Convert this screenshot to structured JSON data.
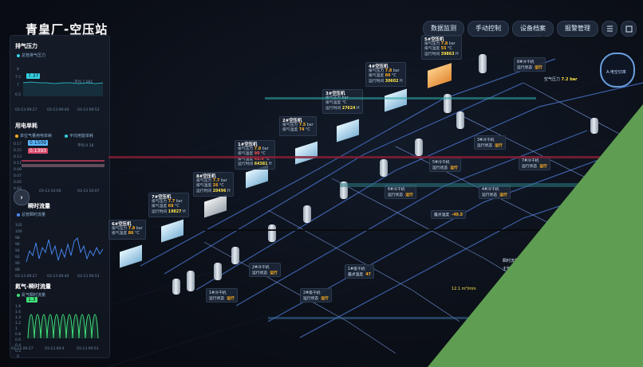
{
  "header": {
    "title": "青皇厂-空压站",
    "buttons": [
      "数据监测",
      "手动控制",
      "设备档案",
      "报警管理"
    ],
    "icons": [
      "list-icon",
      "fullscreen-icon"
    ]
  },
  "left_panel": {
    "pressure": {
      "title": "排气压力",
      "legend": "总管排气压力",
      "badge": "7.37",
      "note": "平均 7.085",
      "y_ticks": [
        "8",
        "7.5",
        "7",
        "6.5"
      ],
      "x_ticks": [
        "03-13 09:27",
        "03-13 09:40",
        "03-13 09:53"
      ]
    },
    "flow": {
      "title": "用电单耗",
      "legend_a": "单位气量用电单耗",
      "legend_b": "平均用能单耗",
      "badge_a": "0.1509",
      "badge_b": "0.1393",
      "right_note": "平均 0.16",
      "y_ticks": [
        "0.17",
        "0.15",
        "0.13",
        "0.11",
        "0.09",
        "0.07",
        "0.05",
        "0.03"
      ],
      "x_ticks": [
        "",
        "03-13 10:00",
        "03-13 10:07"
      ]
    },
    "instant": {
      "title": "瞬时流量",
      "legend": "总管瞬时流量",
      "y_ticks": [
        "102",
        "100",
        "98",
        "96",
        "94",
        "92",
        "90",
        "88"
      ],
      "x_ticks": [
        "03-13 09:27",
        "03-13 09:40",
        "03-13 09:53"
      ]
    },
    "nitrogen": {
      "title": "氮气-瞬时流量",
      "legend": "氮气瞬时流量",
      "badge": "1.3",
      "y_ticks": [
        "1.8",
        "1.6",
        "1.4",
        "1.2",
        "1",
        "0.8",
        "0.6",
        "0.4",
        "0.2",
        "0"
      ],
      "x_ticks": [
        "03-13 09:27",
        "03-13 09:4",
        "03-13 09:53"
      ]
    }
  },
  "compressors": [
    {
      "name": "5#空压机",
      "p": "7.8",
      "t": "55",
      "h": "39863"
    },
    {
      "name": "4#空压机",
      "p": "7.8",
      "t": "80",
      "h": "30602"
    },
    {
      "name": "3#空压机",
      "p": "",
      "t": "",
      "h": "27624"
    },
    {
      "name": "2#空压机",
      "p": "7.5",
      "t": "74",
      "h": "45.4"
    },
    {
      "name": "1#空压机",
      "p": "7.8",
      "t": "90",
      "h": "64381"
    },
    {
      "name": "8#空压机",
      "p": "7.7",
      "t": "26",
      "h": "20496"
    },
    {
      "name": "7#空压机",
      "p": "7.7",
      "t": "69",
      "h": "19827"
    },
    {
      "name": "6#空压机",
      "p": "7.8",
      "t": "86",
      "h": ""
    }
  ],
  "labels": {
    "pressure_row": "排气压力",
    "temp_row": "排气温度",
    "hours_row": "运行时间",
    "unit_bar": "bar",
    "unit_c": "°C",
    "unit_h": "H",
    "run_state": "运行状态",
    "running": "运行",
    "dew": "露点温度"
  },
  "dryers": [
    {
      "name": "8#冷干机",
      "state": "运行"
    },
    {
      "name": "7#冷干机",
      "state": "运行"
    },
    {
      "name": "6#冷干机",
      "state": "运行"
    },
    {
      "name": "5#冷干机",
      "state": "运行"
    },
    {
      "name": "4#冷干机",
      "state": "运行"
    },
    {
      "name": "3#冷干机",
      "state": "运行"
    },
    {
      "name": "2#冷干机",
      "state": "运行"
    },
    {
      "name": "1#冷干机",
      "state": "运行"
    },
    {
      "name": "2#吸干机",
      "state": "运行"
    },
    {
      "name": "1#吸干机",
      "state": "运行"
    }
  ],
  "misc": {
    "air_pressure_label": "空气压力",
    "air_pressure_value": "7.2 bar",
    "dew_value": "-49.5",
    "dew_value2": "47",
    "instant_label": "瞬时流量",
    "instant_value": "22",
    "press_label": "主管压力",
    "press_value": "12",
    "ring_label": "A.电空切率",
    "mid_value": "12.1 m³/min"
  },
  "colors": {
    "accent": "#34d0e0",
    "warn": "#ffb020",
    "alarm": "#ff4b4b",
    "pipe": "#3d5fa8",
    "overlay": "#5f9e52"
  }
}
